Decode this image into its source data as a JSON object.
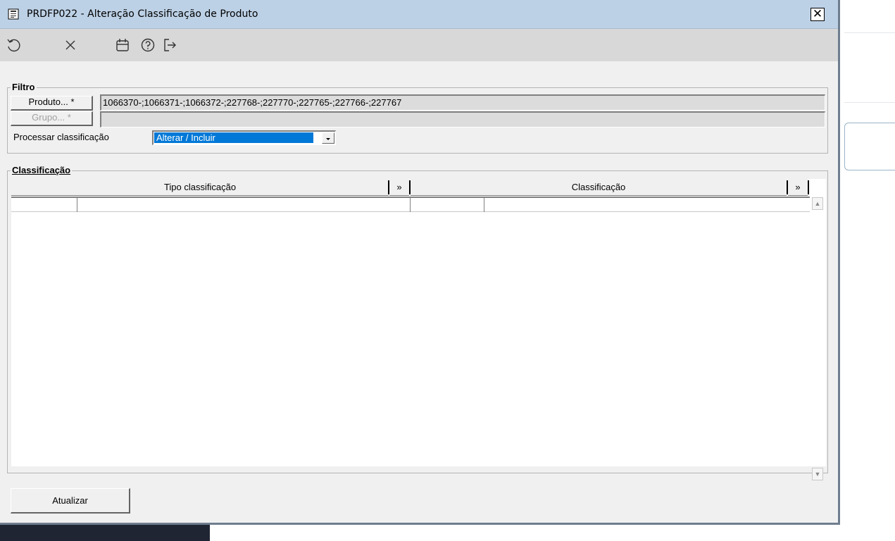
{
  "window": {
    "title": "PRDFP022 - Alteração Classificação de Produto",
    "close_label": "✕"
  },
  "toolbar": {
    "icons": [
      "undo-icon",
      "cancel-icon",
      "calendar-icon",
      "help-icon",
      "exit-icon"
    ]
  },
  "filtro": {
    "legend": "Filtro",
    "produto_button": "Produto... *",
    "produto_value": "1066370-;1066371-;1066372-;227768-;227770-;227765-;227766-;227767",
    "grupo_button": "Grupo... *",
    "grupo_value": "",
    "processar_label": "Processar classificação",
    "processar_value": "Alterar / Incluir"
  },
  "classificacao": {
    "legend": "Classificação",
    "columns": [
      {
        "label": "Tipo classificação",
        "more": "»"
      },
      {
        "label": "Classificação",
        "more": "»"
      }
    ],
    "rows": [
      [
        "",
        "",
        "",
        ""
      ]
    ]
  },
  "footer": {
    "atualizar_label": "Atualizar"
  },
  "colors": {
    "titlebar": "#bdd1e6",
    "toolbar": "#d8d8d8",
    "window_bg": "#f0f0f0",
    "selection": "#0078d7"
  }
}
